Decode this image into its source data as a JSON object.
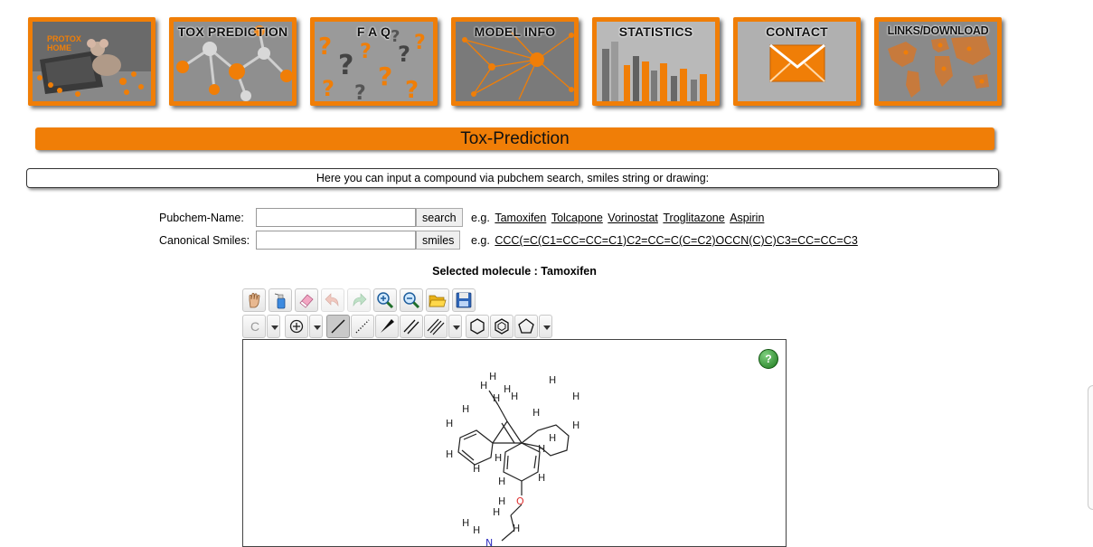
{
  "nav": [
    {
      "label": "PROTOX HOME",
      "name": "nav-protox-home"
    },
    {
      "label": "TOX PREDICTION",
      "name": "nav-tox-prediction"
    },
    {
      "label": "F A Q",
      "name": "nav-faq"
    },
    {
      "label": "MODEL  INFO",
      "name": "nav-model-info"
    },
    {
      "label": "STATISTICS",
      "name": "nav-statistics"
    },
    {
      "label": "CONTACT",
      "name": "nav-contact"
    },
    {
      "label": "LINKS/DOWNLOAD",
      "name": "nav-links-download"
    }
  ],
  "home_label_line1": "PROTOX",
  "home_label_line2": "HOME",
  "page_title": "Tox-Prediction",
  "intro_text": "Here you can input a compound via pubchem search, smiles string or drawing:",
  "pubchem": {
    "label": "Pubchem-Name:",
    "value": "",
    "button": "search",
    "eg": "e.g.",
    "examples": [
      "Tamoxifen",
      "Tolcapone",
      "Vorinostat",
      "Troglitazone",
      "Aspirin"
    ]
  },
  "smiles": {
    "label": "Canonical Smiles:",
    "value": "",
    "button": "smiles",
    "eg": "e.g.",
    "example": "CCC(=C(C1=CC=CC=C1)C2=CC=C(C=C2)OCCN(C)C)C3=CC=CC=C3"
  },
  "selected_molecule": "Selected molecule : Tamoxifen",
  "toolbar": {
    "row1": [
      "hand-icon",
      "spray-bottle-icon",
      "eraser-icon",
      "undo-icon",
      "redo-icon",
      "zoom-in-icon",
      "zoom-out-icon",
      "open-folder-icon",
      "save-icon"
    ],
    "atom_label": "C",
    "row2": [
      "atom-c-button",
      "atom-dropdown",
      "charge-plus-icon",
      "charge-dropdown",
      "single-bond-icon",
      "hash-bond-icon",
      "wedge-bond-icon",
      "double-bond-icon",
      "triple-bond-icon",
      "bond-dropdown",
      "cyclohexane-icon",
      "benzene-icon",
      "cyclopentane-icon",
      "ring-dropdown"
    ]
  },
  "help_label": "?",
  "atoms": {
    "H": "H",
    "O": "O",
    "N": "N"
  },
  "colors": {
    "accent": "#f07e07",
    "oxygen": "#e03030",
    "nitrogen": "#3030c0"
  }
}
